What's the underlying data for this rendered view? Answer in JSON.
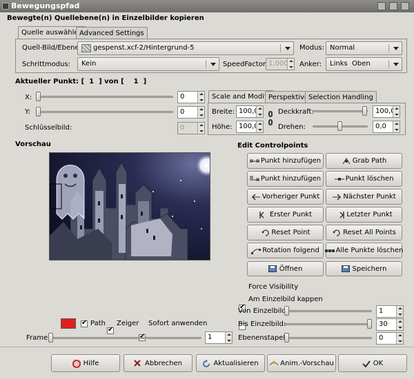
{
  "window_title": "Bewegungspfad",
  "header": "Bewegte(n) Quellebene(n) in Einzelbilder kopieren",
  "top_tabs": [
    "Quelle auswählen",
    "Advanced Settings"
  ],
  "source": {
    "label": "Quell-Bild/Ebene:",
    "value": "gespenst.xcf-2/Hintergrund-5"
  },
  "mode": {
    "label": "Modus:",
    "value": "Normal"
  },
  "step_mode": {
    "label": "Schrittmodus:",
    "value": "Kein"
  },
  "speed": {
    "label": "SpeedFactor:",
    "value": "1,000"
  },
  "anchor": {
    "label": "Anker:",
    "value": "Links  Oben"
  },
  "current_point": {
    "label_a": "Aktueller Punkt: [",
    "num": "1",
    "label_b": "] von [",
    "total": "1",
    "label_c": "]"
  },
  "x": {
    "label": "X:",
    "value": "0"
  },
  "y": {
    "label": "Y:",
    "value": "0"
  },
  "keyframe": {
    "label": "Schlüsselbild:",
    "value": "0"
  },
  "sub_tabs": [
    "Scale and Modify",
    "Perspektive",
    "Selection Handling"
  ],
  "width": {
    "label": "Breite:",
    "value": "100,0"
  },
  "height": {
    "label": "Höhe:",
    "value": "100,0"
  },
  "opacity": {
    "label": "Deckkraft:",
    "value": "100,0",
    "level": 1.0
  },
  "rotate": {
    "label": "Drehen:",
    "value": "0,0",
    "level": 0.5
  },
  "preview_label": "Vorschau",
  "edit_label": "Edit Controlpoints",
  "cp_buttons": [
    [
      "Punkt hinzufügen",
      "Grab Path"
    ],
    [
      "Punkt hinzufügen",
      "Punkt löschen"
    ],
    [
      "Vorheriger Punkt",
      "Nächster Punkt"
    ],
    [
      "Erster Punkt",
      "Letzter Punkt"
    ],
    [
      "Reset Point",
      "Reset All Points"
    ],
    [
      "Rotation folgend",
      "Alle Punkte löschen"
    ],
    [
      "Öffnen",
      "Speichern"
    ]
  ],
  "options": {
    "path": "Path",
    "pointer": "Zeiger",
    "apply": "Sofort anwenden"
  },
  "path_color": "#e02020",
  "frame": {
    "label": "Frame:",
    "value": "1"
  },
  "force_visibility": "Force Visibility",
  "clip": "Am Einzelbild kappen",
  "from_frame": {
    "label": "Von Einzelbild:",
    "value": "1"
  },
  "to_frame": {
    "label": "Bis Einzelbild:",
    "value": "30"
  },
  "stack": {
    "label": "Ebenenstapel:",
    "value": "0"
  },
  "footer_buttons": [
    "Hilfe",
    "Abbrechen",
    "Aktualisieren",
    "Anim.-Vorschau",
    "OK"
  ]
}
